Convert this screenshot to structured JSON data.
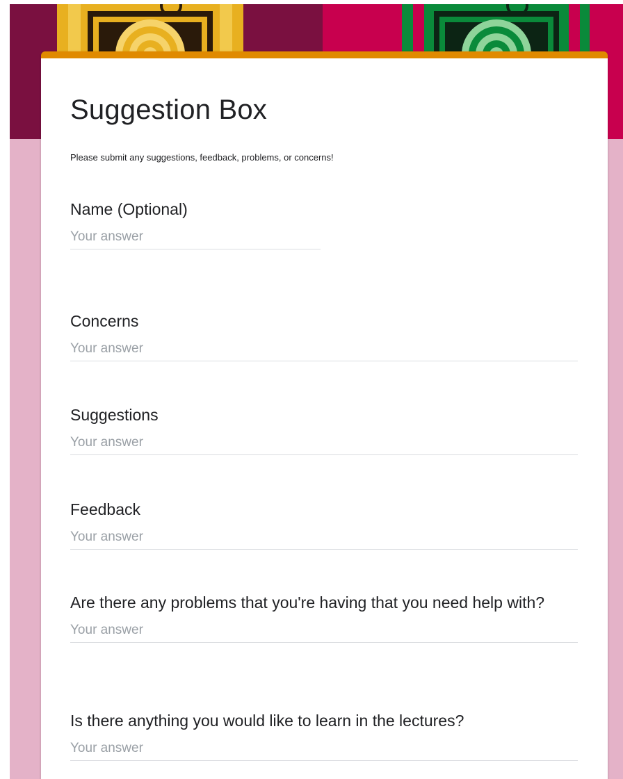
{
  "form": {
    "title": "Suggestion Box",
    "description": "Please submit any suggestions, feedback, problems, or concerns!"
  },
  "questions": [
    {
      "label": "Name (Optional)",
      "placeholder": "Your answer"
    },
    {
      "label": "Concerns",
      "placeholder": "Your answer"
    },
    {
      "label": "Suggestions",
      "placeholder": "Your answer"
    },
    {
      "label": "Feedback",
      "placeholder": "Your answer"
    },
    {
      "label": "Are there any problems that you're having that you need help with?",
      "placeholder": "Your answer"
    },
    {
      "label": "Is there anything you would like to learn in the lectures?",
      "placeholder": "Your answer"
    }
  ],
  "colors": {
    "accent": "#e08a00",
    "page_background": "#e4b2c8",
    "banner_maroon": "#7a1040",
    "banner_crimson": "#c8004e",
    "banner_yellow": "#e8b020",
    "banner_green": "#0a8a3a"
  }
}
